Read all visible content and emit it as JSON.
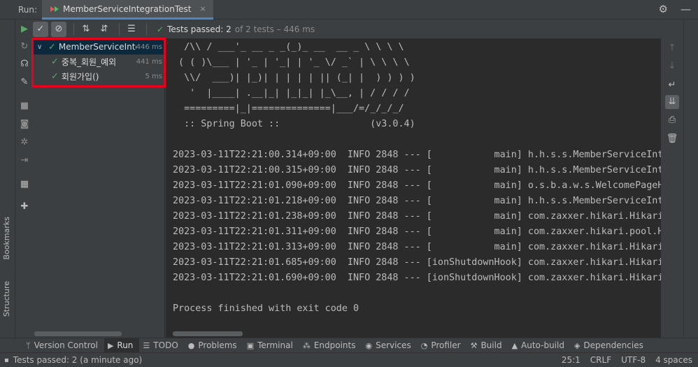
{
  "header": {
    "run_label": "Run:",
    "tab_title": "MemberServiceIntegrationTest",
    "tab_close": "×",
    "settings_icon": "gear-icon",
    "minimize_icon": "minus-icon"
  },
  "test_toolbar": {
    "status_text": "Tests passed: 2",
    "status_detail": "of 2 tests – 446 ms"
  },
  "tree": {
    "root": {
      "name": "MemberServiceInte",
      "time": "446 ms"
    },
    "children": [
      {
        "name": "중복_회원_예외",
        "time": "441 ms"
      },
      {
        "name": "회원가입()",
        "time": "5 ms"
      }
    ]
  },
  "console": {
    "lines": [
      "  /\\\\ / ___'_ __ _ _(_)_ __  __ _ \\ \\ \\ \\",
      " ( ( )\\___ | '_ | '_| | '_ \\/ _` | \\ \\ \\ \\",
      "  \\\\/  ___)| |_)| | | | | || (_| |  ) ) ) )",
      "   '  |____| .__|_| |_|_| |_\\__, | / / / /",
      "  =========|_|==============|___/=/_/_/_/",
      "  :: Spring Boot ::                (v3.0.4)",
      "",
      "2023-03-11T22:21:00.314+09:00  INFO 2848 --- [           main] h.h.s.s.MemberServiceInte",
      "2023-03-11T22:21:00.315+09:00  INFO 2848 --- [           main] h.h.s.s.MemberServiceInte",
      "2023-03-11T22:21:01.090+09:00  INFO 2848 --- [           main] o.s.b.a.w.s.WelcomePageHa",
      "2023-03-11T22:21:01.218+09:00  INFO 2848 --- [           main] h.h.s.s.MemberServiceInte",
      "2023-03-11T22:21:01.238+09:00  INFO 2848 --- [           main] com.zaxxer.hikari.Hikari",
      "2023-03-11T22:21:01.311+09:00  INFO 2848 --- [           main] com.zaxxer.hikari.pool.Hi",
      "2023-03-11T22:21:01.313+09:00  INFO 2848 --- [           main] com.zaxxer.hikari.Hikari",
      "2023-03-11T22:21:01.685+09:00  INFO 2848 --- [ionShutdownHook] com.zaxxer.hikari.Hikari",
      "2023-03-11T22:21:01.690+09:00  INFO 2848 --- [ionShutdownHook] com.zaxxer.hikari.Hikari",
      "",
      "Process finished with exit code 0"
    ]
  },
  "left_strip": {
    "bookmarks_label": "Bookmarks",
    "structure_label": "Structure"
  },
  "bottom_bar": {
    "items": [
      {
        "label": "Version Control"
      },
      {
        "label": "Run"
      },
      {
        "label": "TODO"
      },
      {
        "label": "Problems"
      },
      {
        "label": "Terminal"
      },
      {
        "label": "Endpoints"
      },
      {
        "label": "Services"
      },
      {
        "label": "Profiler"
      },
      {
        "label": "Build"
      },
      {
        "label": "Auto-build"
      },
      {
        "label": "Dependencies"
      }
    ]
  },
  "status_bar": {
    "message": "Tests passed: 2 (a minute ago)",
    "position": "25:1",
    "line_ending": "CRLF",
    "encoding": "UTF-8",
    "indent": "4 spaces"
  },
  "colors": {
    "accent": "#4a88c7",
    "success": "#59a869",
    "highlight_box": "#e8001c"
  }
}
